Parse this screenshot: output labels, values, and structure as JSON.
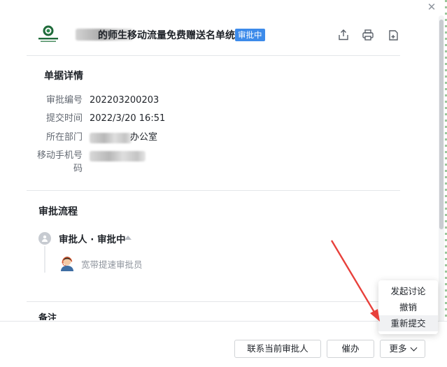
{
  "header": {
    "title": "的师生移动流量免费赠送名单统计",
    "status_badge": "审批中"
  },
  "details": {
    "section_title": "单据详情",
    "fields": [
      {
        "label": "审批编号",
        "value": "202203200203"
      },
      {
        "label": "提交时间",
        "value": "2022/3/20 16:51"
      },
      {
        "label": "所在部门",
        "value": "办公室"
      },
      {
        "label": "移动手机号码",
        "value": ""
      }
    ]
  },
  "flow": {
    "section_title": "审批流程",
    "step_title": "审批人 · 审批中",
    "approver_name": "宽带提速审批员"
  },
  "notes": {
    "title": "备注"
  },
  "footer": {
    "contact_label": "联系当前审批人",
    "urge_label": "催办",
    "more_label": "更多"
  },
  "more_menu": {
    "items": [
      "发起讨论",
      "撤销",
      "重新提交"
    ]
  },
  "colors": {
    "badge": "#3d8bea",
    "arrow": "#e8403b",
    "text": "#1f2329",
    "muted": "#646a73"
  }
}
